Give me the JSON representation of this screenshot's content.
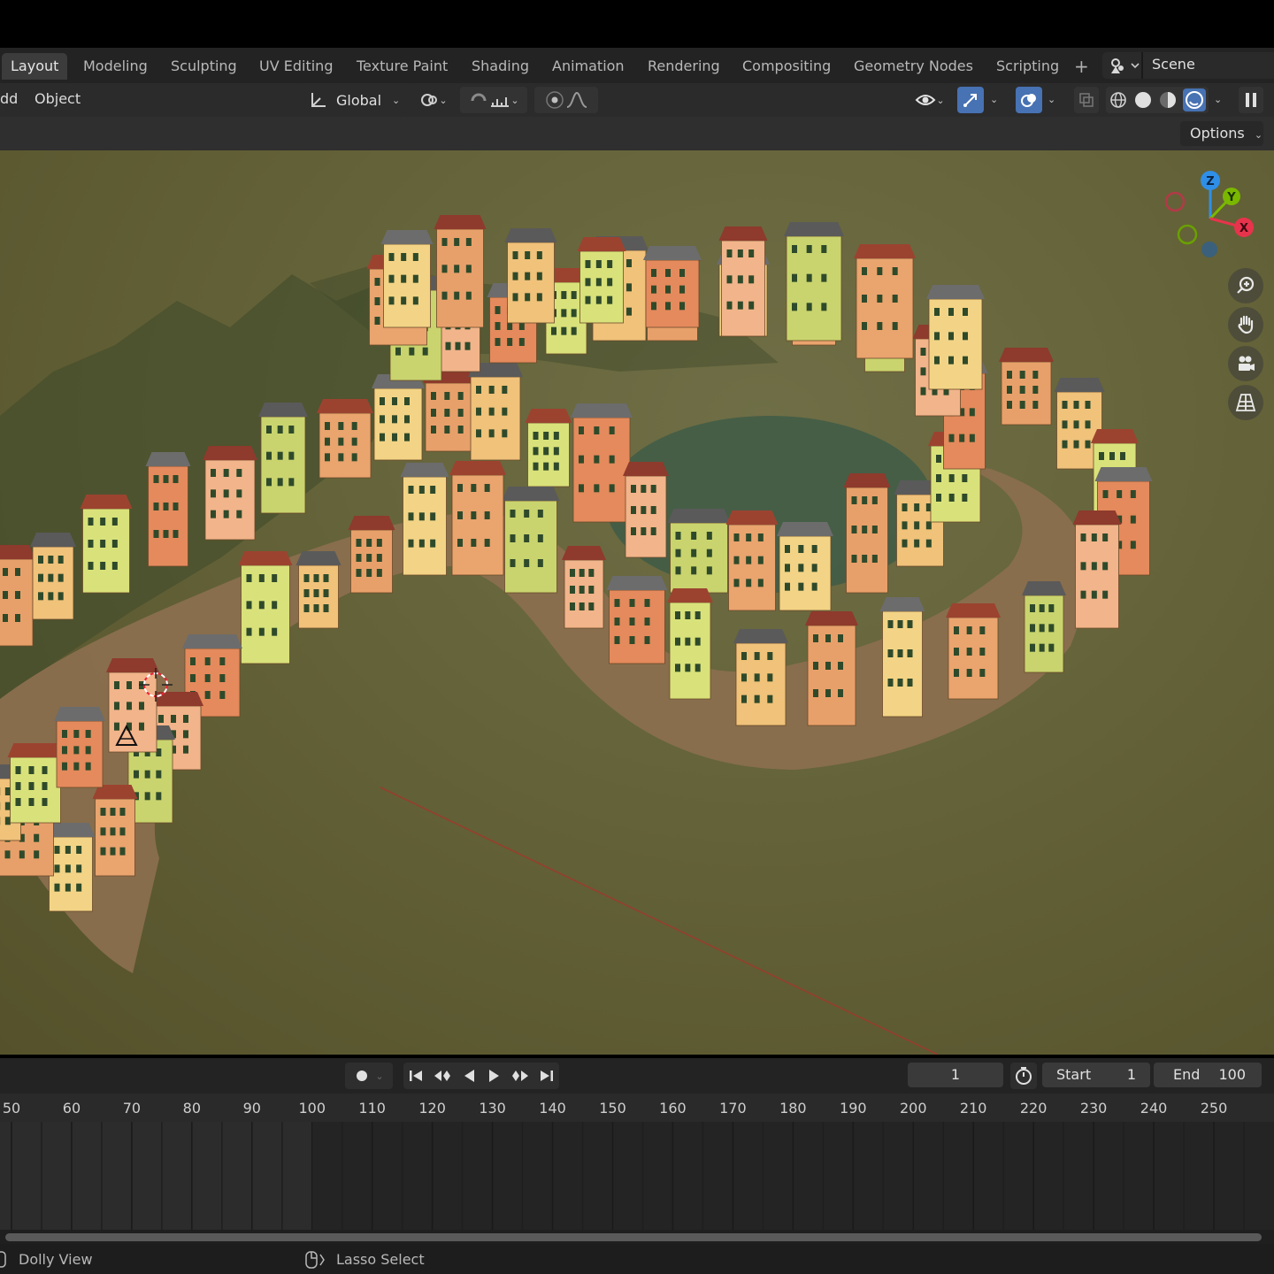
{
  "workspaces": {
    "tabs": [
      {
        "label": "Layout",
        "active": true
      },
      {
        "label": "Modeling"
      },
      {
        "label": "Sculpting"
      },
      {
        "label": "UV Editing"
      },
      {
        "label": "Texture Paint"
      },
      {
        "label": "Shading"
      },
      {
        "label": "Animation"
      },
      {
        "label": "Rendering"
      },
      {
        "label": "Compositing"
      },
      {
        "label": "Geometry Nodes"
      },
      {
        "label": "Scripting"
      }
    ],
    "add_icon": "plus-icon",
    "scene_name": "Scene"
  },
  "header": {
    "menu": {
      "add_label": "dd",
      "object_label": "Object"
    },
    "transform_orientation": "Global",
    "options_label": "Options"
  },
  "gizmo": {
    "z": "Z",
    "y": "Y",
    "x": "X"
  },
  "timeline": {
    "current_frame": "1",
    "start_label": "Start",
    "start_value": "1",
    "end_label": "End",
    "end_value": "100",
    "ruler_ticks": [
      "50",
      "60",
      "70",
      "80",
      "90",
      "100",
      "110",
      "120",
      "130",
      "140",
      "150",
      "160",
      "170",
      "180",
      "190",
      "200",
      "210",
      "220",
      "230",
      "240",
      "250"
    ]
  },
  "status": {
    "left": "Dolly View",
    "mid": "Lasso Select"
  },
  "colors": {
    "accent": "#4772b3",
    "x_axis": "#e8334c",
    "y_axis": "#7ab800",
    "z_axis": "#2f8fe8"
  }
}
